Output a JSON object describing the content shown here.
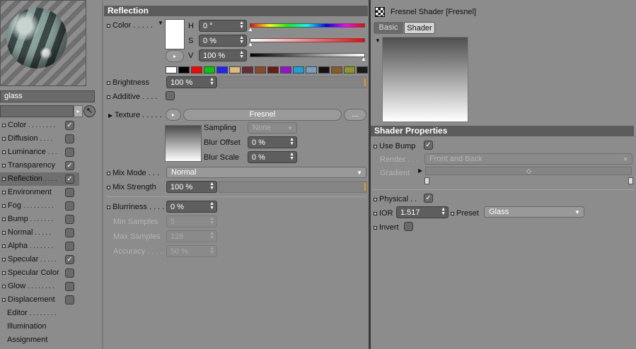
{
  "material": {
    "name": "glass",
    "channels": [
      {
        "label": "Color",
        "dots": ". . . . . . . .",
        "checked": true,
        "selected": false
      },
      {
        "label": "Diffusion",
        "dots": ". . . .",
        "checked": false,
        "selected": false
      },
      {
        "label": "Luminance",
        "dots": ". . .",
        "checked": false,
        "selected": false
      },
      {
        "label": "Transparency",
        "dots": "",
        "checked": true,
        "selected": false
      },
      {
        "label": "Reflection",
        "dots": ". . . .",
        "checked": true,
        "selected": true
      },
      {
        "label": "Environment",
        "dots": "",
        "checked": false,
        "selected": false
      },
      {
        "label": "Fog",
        "dots": ". . . . . . . . .",
        "checked": false,
        "selected": false
      },
      {
        "label": "Bump",
        "dots": ". . . . . . .",
        "checked": false,
        "selected": false
      },
      {
        "label": "Normal",
        "dots": ". . . . .",
        "checked": false,
        "selected": false
      },
      {
        "label": "Alpha",
        "dots": ". . . . . . .",
        "checked": false,
        "selected": false
      },
      {
        "label": "Specular",
        "dots": ". . . . .",
        "checked": true,
        "selected": false
      },
      {
        "label": "Specular Color",
        "dots": "",
        "checked": false,
        "selected": false
      },
      {
        "label": "Glow",
        "dots": ". . . . . . . .",
        "checked": false,
        "selected": false
      },
      {
        "label": "Displacement",
        "dots": "",
        "checked": false,
        "selected": false
      }
    ],
    "extra_items": [
      {
        "label": "Editor",
        "dots": ". . . . . . . ."
      },
      {
        "label": "Illumination",
        "dots": ""
      },
      {
        "label": "Assignment",
        "dots": ""
      }
    ]
  },
  "reflection": {
    "title": "Reflection",
    "color_label": "Color",
    "color_dots": ". . . . .",
    "h_label": "H",
    "h_value": "0 °",
    "s_label": "S",
    "s_value": "0 %",
    "v_label": "V",
    "v_value": "100 %",
    "swatches": [
      "#ffffff",
      "#000000",
      "#ff0000",
      "#00cc00",
      "#2222ff",
      "#dcbc7a",
      "#6b2a3a",
      "#8a4a28",
      "#6a1a10",
      "#9a10d0",
      "#1aa0e0",
      "#7aa0c0",
      "#111111",
      "#8a5a2a",
      "#8a9a20",
      "#1a1a1a"
    ],
    "brightness_label": "Brightness",
    "brightness_value": "100 %",
    "additive_label": "Additive",
    "additive_dots": ". . . .",
    "texture_label": "Texture",
    "texture_dots": ". . . . .",
    "texture_name": "Fresnel",
    "texture_more": "...",
    "sampling_label": "Sampling",
    "sampling_value": "None",
    "blur_offset_label": "Blur Offset",
    "blur_offset_value": "0 %",
    "blur_scale_label": "Blur Scale",
    "blur_scale_value": "0 %",
    "mix_mode_label": "Mix Mode",
    "mix_mode_dots": ". . .",
    "mix_mode_value": "Normal",
    "mix_strength_label": "Mix Strength",
    "mix_strength_value": "100 %",
    "blurriness_label": "Blurriness",
    "blurriness_dots": ". . . .",
    "blurriness_value": "0 %",
    "min_samples_label": "Min Samples",
    "min_samples_value": "5",
    "max_samples_label": "Max Samples",
    "max_samples_value": "128",
    "accuracy_label": "Accuracy",
    "accuracy_dots": ". . . .",
    "accuracy_value": "50 %"
  },
  "shader": {
    "title": "Fresnel Shader [Fresnel]",
    "tabs": [
      "Basic",
      "Shader"
    ],
    "active_tab": "Shader",
    "props_title": "Shader Properties",
    "use_bump_label": "Use Bump",
    "render_label": "Render",
    "render_dots": ". . .",
    "render_value": "Front and Back",
    "gradient_label": "Gradient",
    "physical_label": "Physical",
    "physical_dots": ". .",
    "ior_label": "IOR",
    "ior_value": "1.517",
    "preset_label": "Preset",
    "preset_value": "Glass",
    "invert_label": "Invert"
  },
  "colors": {
    "panel_bg": "#8c8c8c",
    "section_head": "#5c5c5c",
    "field_bg": "#5e5e5e",
    "accent_orange": "#e89a20"
  }
}
